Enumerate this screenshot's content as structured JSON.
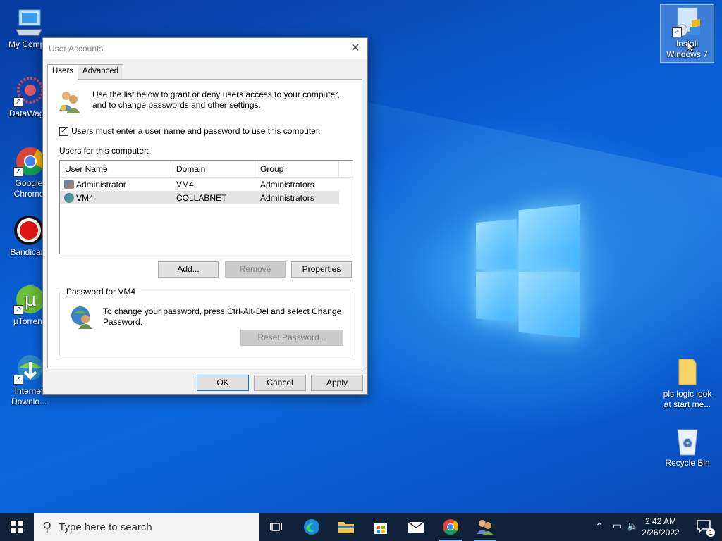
{
  "desktop": {
    "icons_left": [
      {
        "label": "My Compu"
      },
      {
        "label": "DataWago"
      },
      {
        "label": "Google Chrome"
      },
      {
        "label": "Bandicam"
      },
      {
        "label": "µTorrent"
      },
      {
        "label": "Internet Downlo..."
      }
    ],
    "icons_right": [
      {
        "label": "Install Windows 7"
      },
      {
        "label": "pls logic look at start me..."
      },
      {
        "label": "Recycle Bin"
      }
    ]
  },
  "dialog": {
    "title": "User Accounts",
    "tabs": [
      {
        "label": "Users"
      },
      {
        "label": "Advanced"
      }
    ],
    "intro": "Use the list below to grant or deny users access to your computer, and to change passwords and other settings.",
    "require_login_label": "Users must enter a user name and password to use this computer.",
    "require_login_checked": true,
    "users_label": "Users for this computer:",
    "columns": [
      "User Name",
      "Domain",
      "Group"
    ],
    "users": [
      {
        "name": "Administrator",
        "domain": "VM4",
        "group": "Administrators"
      },
      {
        "name": "VM4",
        "domain": "COLLABNET",
        "group": "Administrators"
      }
    ],
    "buttons": {
      "add": "Add...",
      "remove": "Remove",
      "properties": "Properties"
    },
    "password_group_title": "Password for VM4",
    "password_text": "To change your password, press Ctrl-Alt-Del and select Change Password.",
    "reset_password": "Reset Password...",
    "footer": {
      "ok": "OK",
      "cancel": "Cancel",
      "apply": "Apply"
    }
  },
  "taskbar": {
    "search_placeholder": "Type here to search",
    "time": "2:42 AM",
    "date": "2/26/2022",
    "notification_count": "1"
  },
  "colors": {
    "accent": "#0078d7",
    "taskbar": "#10223a"
  }
}
